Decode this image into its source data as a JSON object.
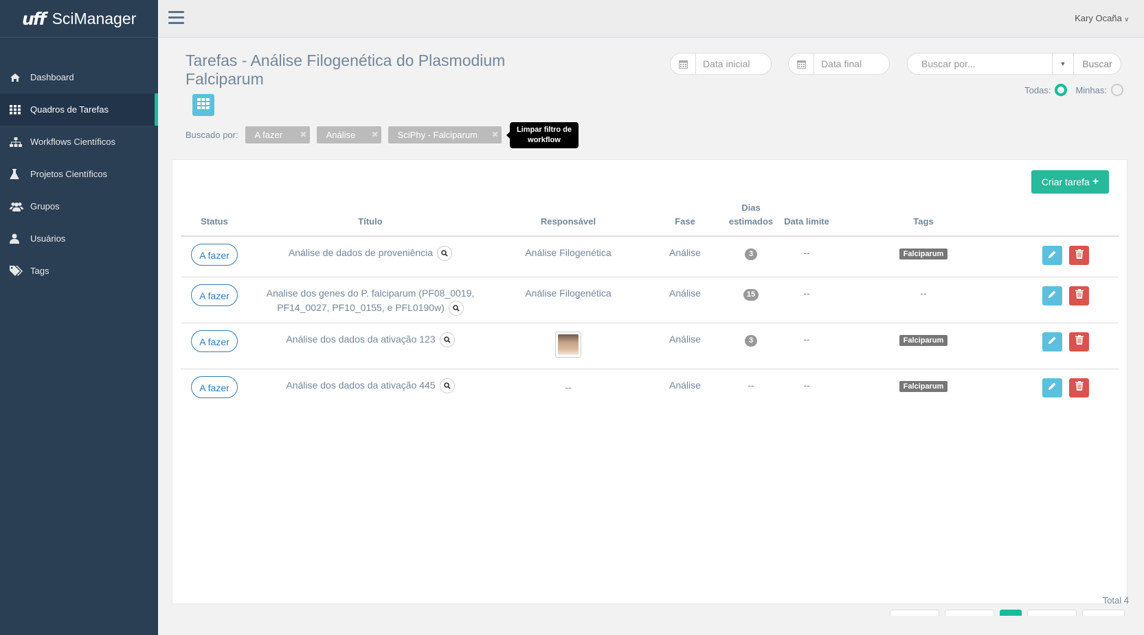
{
  "brand": {
    "logo": "uff",
    "name": "SciManager"
  },
  "sidebar": {
    "items": [
      {
        "label": "Dashboard",
        "icon": "home-icon"
      },
      {
        "label": "Quadros de Tarefas",
        "icon": "grid-icon",
        "active": true
      },
      {
        "label": "Workflows Científicos",
        "icon": "sitemap-icon"
      },
      {
        "label": "Projetos Científicos",
        "icon": "flask-icon"
      },
      {
        "label": "Grupos",
        "icon": "users-icon"
      },
      {
        "label": "Usuários",
        "icon": "user-icon"
      },
      {
        "label": "Tags",
        "icon": "tags-icon"
      }
    ]
  },
  "topbar": {
    "user": "Kary Ocaña"
  },
  "header": {
    "title": "Tarefas - Análise Filogenética do Plasmodium Falciparum",
    "date_start_placeholder": "Data inicial",
    "date_end_placeholder": "Data final",
    "search_placeholder": "Buscar por...",
    "search_button": "Buscar",
    "scope_all": "Todas:",
    "scope_mine": "Minhas:"
  },
  "filters": {
    "label": "Buscado por:",
    "chips": [
      "A fazer",
      "Análise",
      "SciPhy - Falciparum"
    ],
    "tooltip": "Limpar filtro de workflow"
  },
  "panel": {
    "create_button": "Criar tarefa"
  },
  "table": {
    "columns": [
      "Status",
      "Título",
      "Responsável",
      "Fase",
      "Dias estimados",
      "Data limite",
      "Tags"
    ],
    "rows": [
      {
        "status": "A fazer",
        "title": "Análise de dados de proveniência",
        "responsible": "Análise Filogenética",
        "phase": "Análise",
        "days": "3",
        "deadline": "--",
        "tag": "Falciparum"
      },
      {
        "status": "A fazer",
        "title": "Analise dos genes do P. falciparum (PF08_0019, PF14_0027, PF10_0155, e PFL0190w)",
        "responsible": "Análise Filogenética",
        "phase": "Análise",
        "days": "15",
        "deadline": "--",
        "tag": "--"
      },
      {
        "status": "A fazer",
        "title": "Análise dos dados da ativação 123",
        "responsible": "",
        "phase": "Análise",
        "days": "3",
        "deadline": "--",
        "tag": "Falciparum"
      },
      {
        "status": "A fazer",
        "title": "Análise dos dados da ativação 445",
        "responsible": "--",
        "phase": "Análise",
        "days": "--",
        "deadline": "--",
        "tag": "Falciparum"
      }
    ]
  },
  "footer": {
    "total": "Total 4"
  },
  "colors": {
    "sidebar": "#2a3f54",
    "accent": "#1abb9c",
    "primary_button": "#26b99a",
    "edit": "#5bc0de",
    "delete": "#d9534f"
  }
}
